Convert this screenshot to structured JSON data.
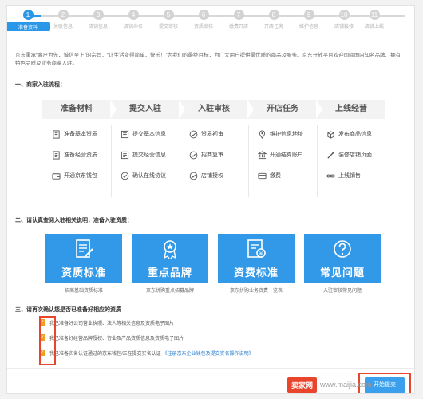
{
  "steps": [
    {
      "label": "准备资料",
      "num": "1",
      "active": true
    },
    {
      "label": "关联信息",
      "num": "2"
    },
    {
      "label": "店铺信息",
      "num": "3"
    },
    {
      "label": "店铺命名",
      "num": "4"
    },
    {
      "label": "提交审核",
      "num": "5"
    },
    {
      "label": "资质审核",
      "num": "6"
    },
    {
      "label": "缴费开店",
      "num": "7"
    },
    {
      "label": "开店任务",
      "num": "8"
    },
    {
      "label": "维护信息",
      "num": "9"
    },
    {
      "label": "店铺装修",
      "num": "10"
    },
    {
      "label": "店铺上线",
      "num": "11"
    }
  ],
  "intro": "京东秉承“客户为先，诚信至上”的宗旨，“让生活变得简单，快乐！”为我们的最终目标，为广大用户提供最优质的商品及服务。京东开放平台欢迎国际国内知名品牌、拥有特色品质及业务商家入驻。",
  "section1": {
    "num": "一、",
    "title": "商家入驻流程："
  },
  "flow": {
    "stages": [
      "准备材料",
      "提交入驻",
      "入驻审核",
      "开店任务",
      "上线经营"
    ],
    "columns": [
      [
        {
          "icon": "document-icon",
          "text": "准备基本资质"
        },
        {
          "icon": "document-icon",
          "text": "准备经营资质"
        },
        {
          "icon": "wallet-icon",
          "text": "开通京东钱包"
        }
      ],
      [
        {
          "icon": "form-icon",
          "text": "提交基本信息"
        },
        {
          "icon": "form-icon",
          "text": "提交经营信息"
        },
        {
          "icon": "check-circle-icon",
          "text": "确认在线协议"
        }
      ],
      [
        {
          "icon": "check-circle-icon",
          "text": "资质初审"
        },
        {
          "icon": "check-circle-icon",
          "text": "招商复审"
        },
        {
          "icon": "check-circle-icon",
          "text": "店铺授权"
        }
      ],
      [
        {
          "icon": "pin-icon",
          "text": "维护信息地址"
        },
        {
          "icon": "bank-icon",
          "text": "开通结算账户"
        },
        {
          "icon": "payment-icon",
          "text": "缴费"
        }
      ],
      [
        {
          "icon": "product-icon",
          "text": "发布商品信息"
        },
        {
          "icon": "brush-icon",
          "text": "装修店铺页面"
        },
        {
          "icon": "link-icon",
          "text": "上线销售"
        }
      ]
    ]
  },
  "section2": {
    "num": "二、",
    "title": "请认真查阅入驻相关说明，准备入驻资质："
  },
  "cards": [
    {
      "title": "资质标准",
      "caption": "招商基础资质标准",
      "icon": "edit-doc-icon"
    },
    {
      "title": "重点品牌",
      "caption": "京东拼购重点招募品牌",
      "icon": "medal-icon"
    },
    {
      "title": "资费标准",
      "caption": "京东拼购业务资费一览表",
      "icon": "fee-doc-icon"
    },
    {
      "title": "常见问题",
      "caption": "入驻审核常见问题",
      "icon": "question-icon"
    }
  ],
  "section3": {
    "num": "三、",
    "title": "请再次确认您是否已准备好相应的资质"
  },
  "checks": [
    {
      "text": "我已准备好公司营业执照、法人等相关信息及资质电子图片",
      "link": ""
    },
    {
      "text": "我已准备好经营品牌授权、行业及产品资质信息及资质电子图片",
      "link": ""
    },
    {
      "text": "我已准备实名认证通过的京东钱包/正在提交实名认证",
      "link": "《注册京东企业钱包及提交实名操作说明》"
    }
  ],
  "next_button": "开始提交",
  "watermark": {
    "logo": "卖家网",
    "url": "www.maijia.com"
  }
}
